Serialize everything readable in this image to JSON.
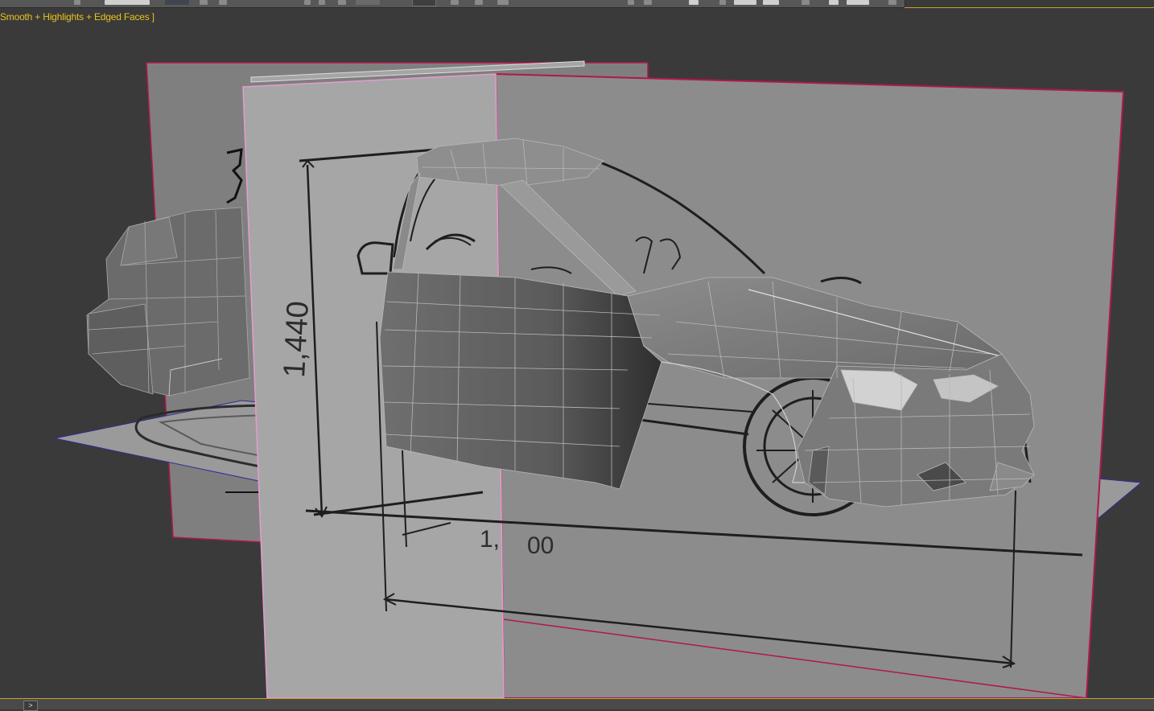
{
  "viewport": {
    "label": "Smooth + Highlights + Edged Faces ]",
    "dimension_height_label": "1,440",
    "dimension_bottom_fragment_1": "1,",
    "dimension_bottom_fragment_2": "00",
    "colors": {
      "background": "#3a3a3a",
      "plane": "#9b9b9b",
      "mesh": "#7d7d7d",
      "label": "#e8c21c",
      "plane_border": "#b0184a"
    }
  },
  "toolbar": {
    "icons": [
      "move-icon",
      "rotate-icon",
      "scale-icon",
      "snap-icon",
      "mirror-icon",
      "align-icon",
      "layer-icon",
      "render-icon"
    ]
  },
  "statusbar": {
    "arrow_label": ">"
  }
}
